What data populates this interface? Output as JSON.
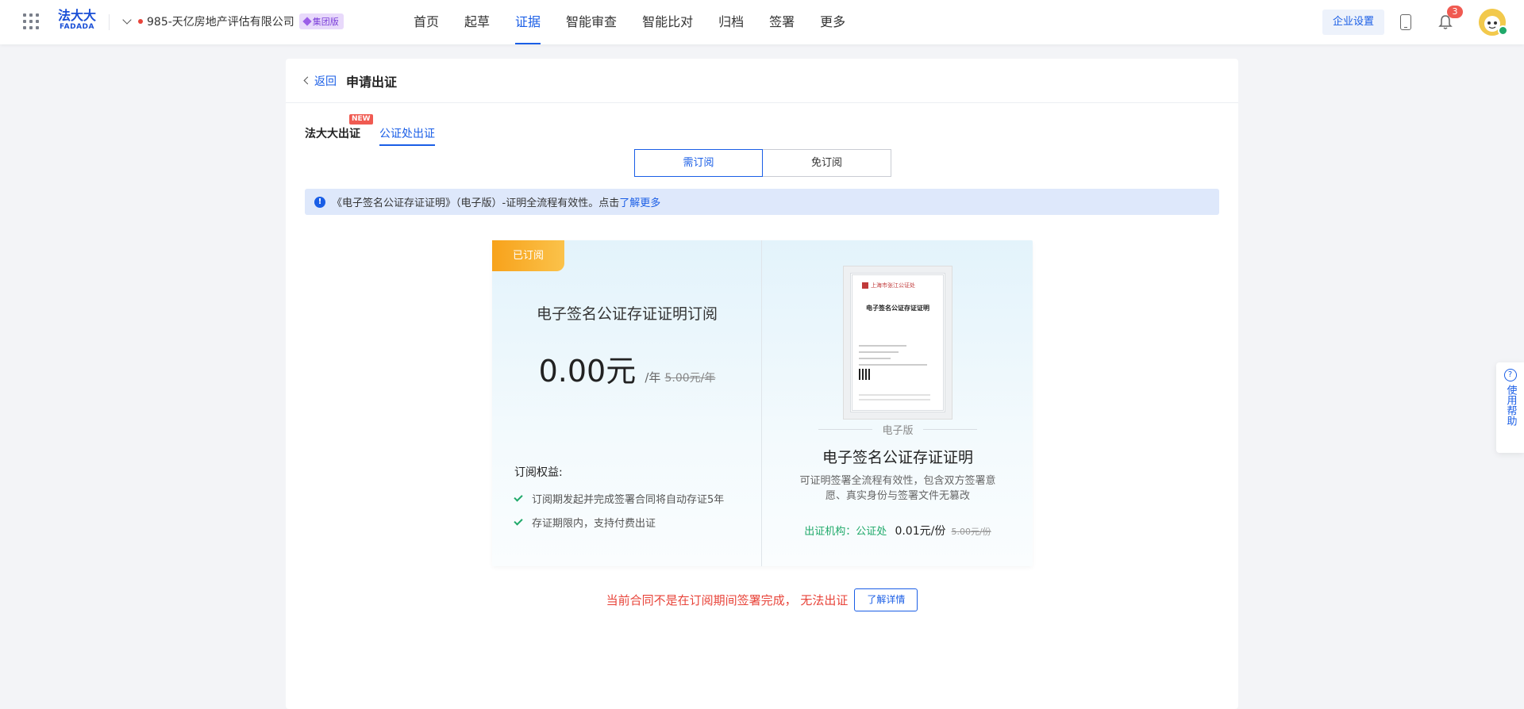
{
  "topbar": {
    "logo_cn": "法大大",
    "logo_en": "FADADA",
    "company_name": "985-天亿房地产评估有限公司",
    "edition_badge": "集团版",
    "nav": [
      "首页",
      "起草",
      "证据",
      "智能审查",
      "智能比对",
      "归档",
      "签署",
      "更多"
    ],
    "active_nav": "证据",
    "enterprise_settings": "企业设置",
    "notification_count": "3"
  },
  "header": {
    "back_label": "返回",
    "title": "申请出证"
  },
  "subtabs": {
    "items": [
      "法大大出证",
      "公证处出证"
    ],
    "active": "公证处出证",
    "new_tag": "NEW"
  },
  "segment": {
    "options": [
      "需订阅",
      "免订阅"
    ],
    "active": "需订阅"
  },
  "info_bar": {
    "text": "《电子签名公证存证证明》（电子版）-证明全流程有效性。点击",
    "link": "了解更多"
  },
  "subscription": {
    "status_tag": "已订阅",
    "title": "电子签名公证存证证明订阅",
    "price": "0.00元",
    "per_year": "/年",
    "old_price": "5.00元/年",
    "benefits_title": "订阅权益:",
    "benefits": [
      "订阅期发起并完成签署合同将自动存证5年",
      "存证期限内，支持付费出证"
    ]
  },
  "certificate": {
    "issuer_line": "上海市张江公证处",
    "doc_heading": "电子签名公证存证证明",
    "edition": "电子版",
    "title": "电子签名公证存证证明",
    "description": "可证明签署全流程有效性，包含双方签署意愿、真实身份与签署文件无篡改",
    "org_label": "出证机构：公证处",
    "price": "0.01元/份",
    "old_price": "5.00元/份"
  },
  "warning": {
    "text": "当前合同不是在订阅期间签署完成， 无法出证",
    "detail_button": "了解详情"
  },
  "help": {
    "label": "使用帮助"
  },
  "colors": {
    "accent": "#1a5ee6",
    "success": "#1fa96a",
    "warning": "#e8443a",
    "tag_orange": "#f7a21b"
  }
}
